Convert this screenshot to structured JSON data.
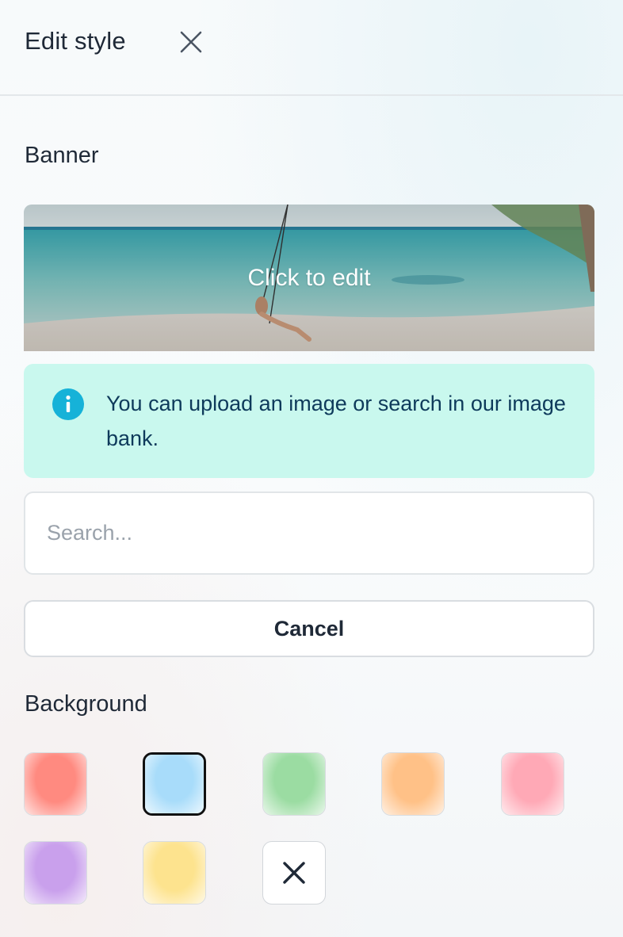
{
  "header": {
    "title": "Edit style",
    "close_icon": "close-icon"
  },
  "banner": {
    "section_label": "Banner",
    "overlay_label": "Click to edit"
  },
  "info": {
    "icon": "info-icon",
    "text": "You can upload an image or search in our image bank."
  },
  "search": {
    "placeholder": "Search...",
    "value": ""
  },
  "cancel": {
    "label": "Cancel"
  },
  "background": {
    "section_label": "Background",
    "swatches": [
      {
        "name": "red",
        "color": "#ff8a80",
        "selected": false
      },
      {
        "name": "blue",
        "color": "#a8dcfa",
        "selected": true
      },
      {
        "name": "green",
        "color": "#9bdca2",
        "selected": false
      },
      {
        "name": "orange",
        "color": "#ffc187",
        "selected": false
      },
      {
        "name": "pink",
        "color": "#ffa9b6",
        "selected": false
      },
      {
        "name": "purple",
        "color": "#c9a0ec",
        "selected": false
      },
      {
        "name": "yellow",
        "color": "#fde38e",
        "selected": false
      }
    ],
    "none_icon": "x-icon"
  },
  "colors": {
    "info_bg": "#c9f8ee",
    "info_icon": "#16b2d8",
    "info_text": "#0e3a5b"
  }
}
